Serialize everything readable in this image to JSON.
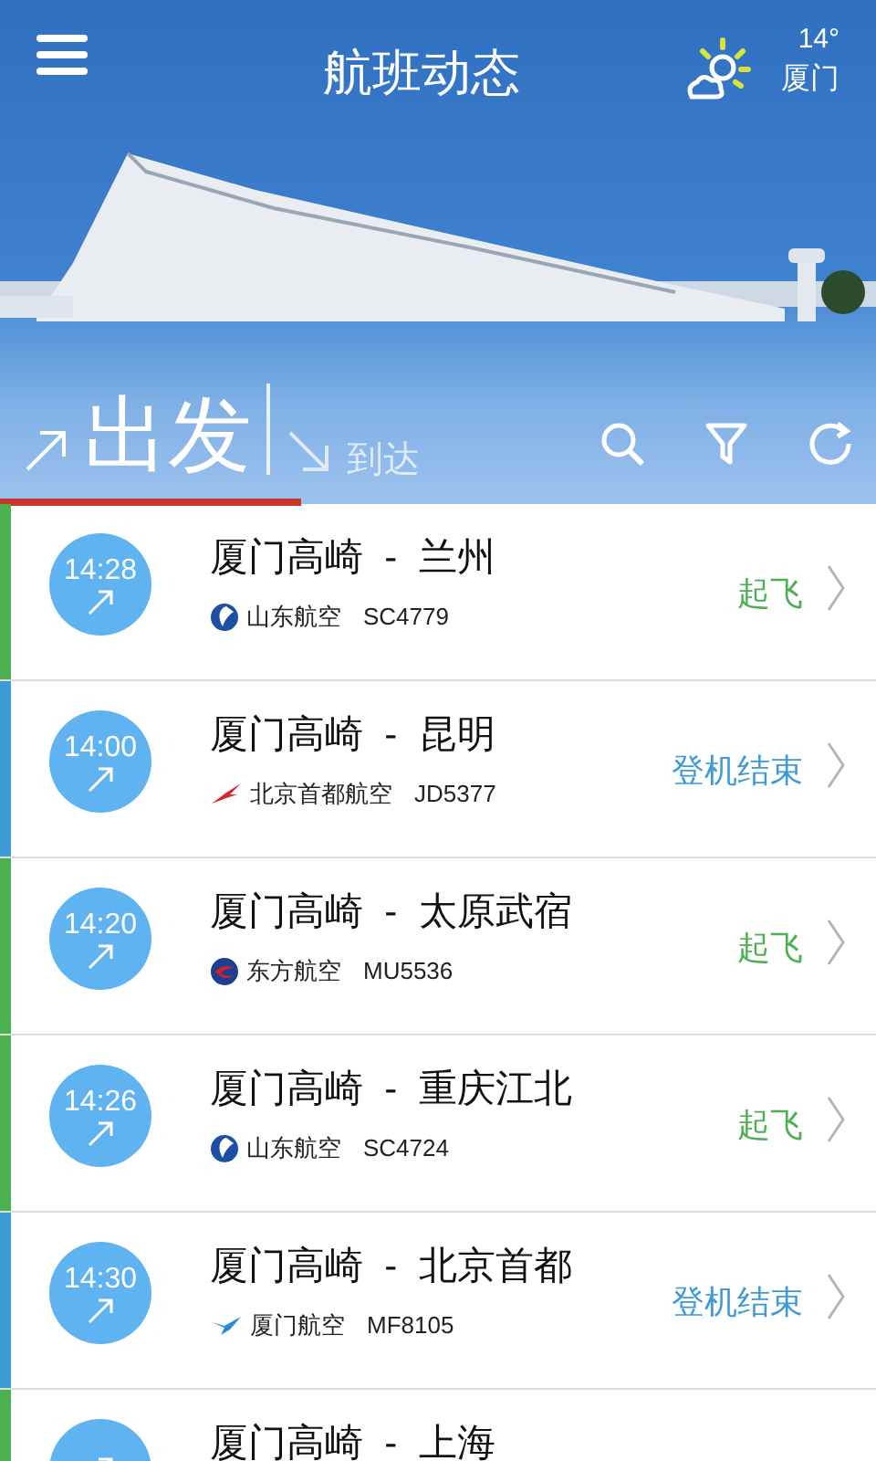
{
  "header": {
    "title": "航班动态",
    "weather": {
      "temperature": "14°",
      "city": "厦门"
    }
  },
  "tabs": [
    {
      "label": "出发",
      "selected": true
    },
    {
      "label": "到达",
      "selected": false
    }
  ],
  "flights": [
    {
      "time": "14:28",
      "route": "厦门高崎  -  兰州",
      "airline": "山东航空",
      "kind": "swirl",
      "flight_no": "SC4779",
      "status": "起飞",
      "color": "#4caf50"
    },
    {
      "time": "14:00",
      "route": "厦门高崎  -  昆明",
      "airline": "北京首都航空",
      "kind": "bird",
      "flight_no": "JD5377",
      "status": "登机结束",
      "color": "#3d9ad6"
    },
    {
      "time": "14:20",
      "route": "厦门高崎  -  太原武宿",
      "airline": "东方航空",
      "kind": "circle",
      "flight_no": "MU5536",
      "status": "起飞",
      "color": "#4caf50"
    },
    {
      "time": "14:26",
      "route": "厦门高崎  -  重庆江北",
      "airline": "山东航空",
      "kind": "swirl",
      "flight_no": "SC4724",
      "status": "起飞",
      "color": "#4caf50"
    },
    {
      "time": "14:30",
      "route": "厦门高崎  -  北京首都",
      "airline": "厦门航空",
      "kind": "egret",
      "flight_no": "MF8105",
      "status": "登机结束",
      "color": "#3d9ad6"
    },
    {
      "route": "厦门高崎  -  上海",
      "color": "#4caf50"
    }
  ]
}
